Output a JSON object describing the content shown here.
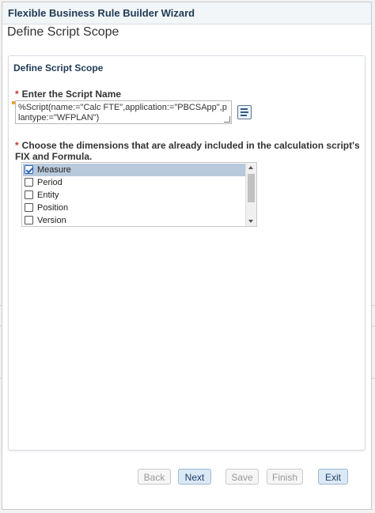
{
  "window": {
    "title": "Flexible Business Rule Builder Wizard"
  },
  "page": {
    "title": "Define Script Scope"
  },
  "panel": {
    "header": "Define Script Scope",
    "script_name": {
      "required_mark": "*",
      "label": "Enter the Script Name",
      "value": "%Script(name:=\"Calc FTE\",application:=\"PBCSApp\",plantype:=\"WFPLAN\")",
      "picker_icon": "member-selector-icon"
    },
    "dimensions": {
      "required_mark": "*",
      "label": "Choose the dimensions that are already included in the calculation script's FIX and Formula.",
      "items": [
        {
          "label": "Measure",
          "checked": true
        },
        {
          "label": "Period",
          "checked": false
        },
        {
          "label": "Entity",
          "checked": false
        },
        {
          "label": "Position",
          "checked": false
        },
        {
          "label": "Version",
          "checked": false
        }
      ]
    }
  },
  "buttons": {
    "back": "Back",
    "next": "Next",
    "save": "Save",
    "finish": "Finish",
    "exit": "Exit"
  }
}
